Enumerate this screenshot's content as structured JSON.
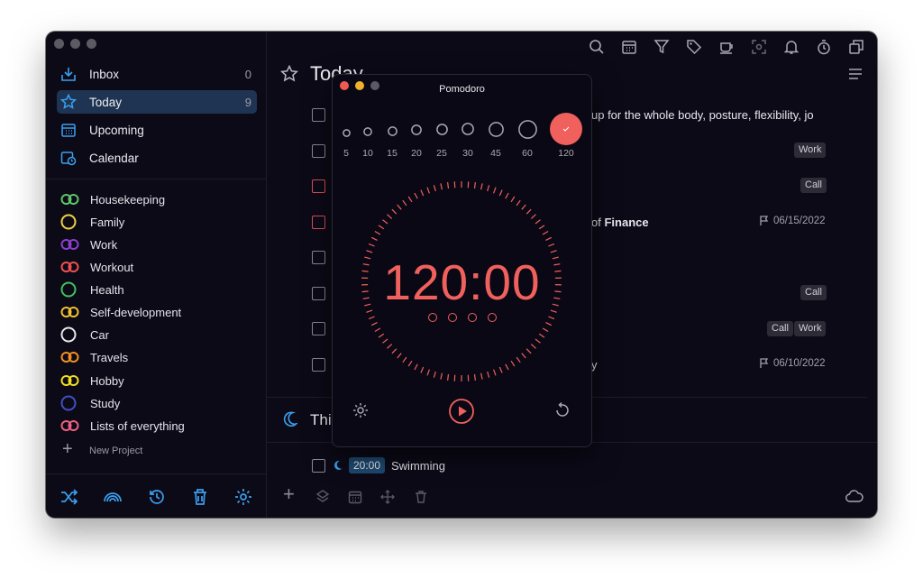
{
  "sidebar": {
    "nav": [
      {
        "label": "Inbox",
        "count": "0",
        "icon": "inbox-icon"
      },
      {
        "label": "Today",
        "count": "9",
        "icon": "star-icon"
      },
      {
        "label": "Upcoming",
        "count": "",
        "icon": "calendar-grid-icon"
      },
      {
        "label": "Calendar",
        "count": "",
        "icon": "calendar-clock-icon"
      }
    ],
    "projects": [
      {
        "label": "Housekeeping",
        "color": "#5ec46a"
      },
      {
        "label": "Family",
        "color": "#f0d040"
      },
      {
        "label": "Work",
        "color": "#8a3fd0"
      },
      {
        "label": "Workout",
        "color": "#f05050"
      },
      {
        "label": "Health",
        "color": "#40c060"
      },
      {
        "label": "Self-development",
        "color": "#f0c030"
      },
      {
        "label": "Car",
        "color": "#e8e8e8"
      },
      {
        "label": "Travels",
        "color": "#f09020"
      },
      {
        "label": "Hobby",
        "color": "#f0e020"
      },
      {
        "label": "Study",
        "color": "#4050c0"
      },
      {
        "label": "Lists of everything",
        "color": "#f06080"
      }
    ],
    "new_project": "New Project"
  },
  "main": {
    "section_title": "Today",
    "next_section_title": "Thi",
    "tasks": [
      {
        "text": "up for the whole body, posture, flexibility, jo",
        "tags": [],
        "date": ""
      },
      {
        "text": "",
        "tags": [
          "Work"
        ],
        "date": ""
      },
      {
        "text": "",
        "tags": [
          "Call"
        ],
        "date": ""
      },
      {
        "text_prefix": "of ",
        "text_bold": "Finance",
        "tags": [],
        "date": "06/15/2022"
      },
      {
        "text": "",
        "tags": [],
        "date": ""
      },
      {
        "text": "",
        "tags": [
          "Call"
        ],
        "date": ""
      },
      {
        "text": "",
        "tags": [
          "Call",
          "Work"
        ],
        "date": ""
      },
      {
        "text": "y",
        "tags": [],
        "date": "06/10/2022"
      }
    ],
    "bottom_task": {
      "time": "20:00",
      "text": "Swimming"
    }
  },
  "pomodoro": {
    "title": "Pomodoro",
    "presets": [
      "5",
      "10",
      "15",
      "20",
      "25",
      "30",
      "45",
      "60",
      "120"
    ],
    "selected": "120",
    "timer": "120:00",
    "sessions": 4
  },
  "colors": {
    "accent": "#3aa0f0",
    "timer": "#f0605c",
    "background": "#0c0a17"
  }
}
